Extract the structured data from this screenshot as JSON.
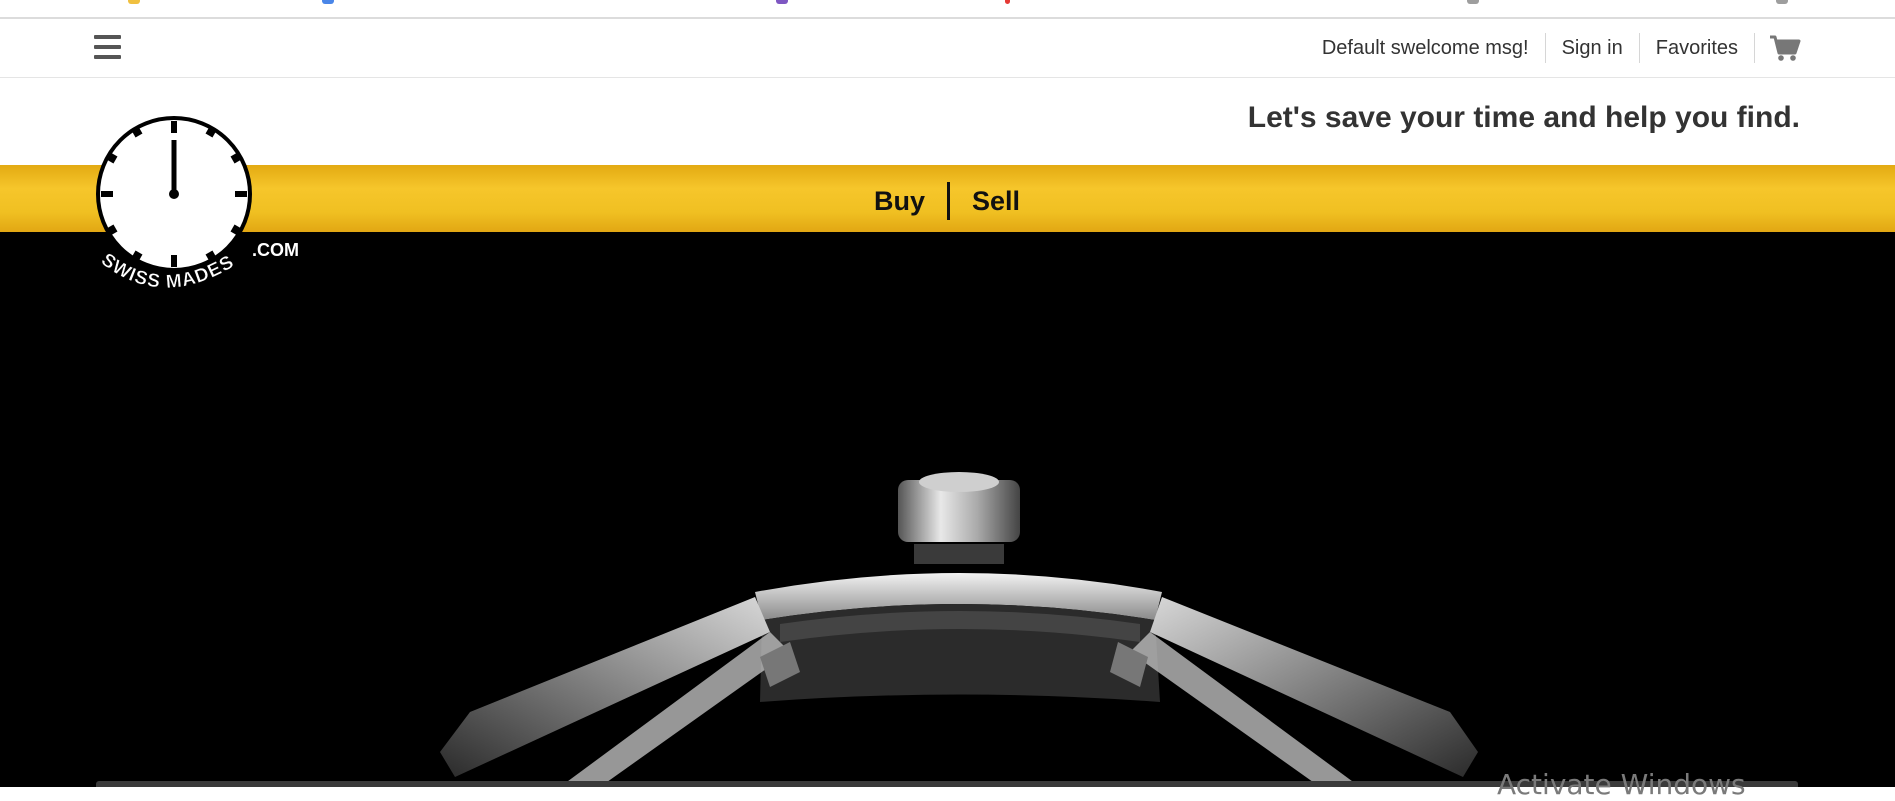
{
  "header": {
    "welcome": "Default swelcome msg!",
    "sign_in": "Sign in",
    "favorites": "Favorites",
    "tagline": "Let's save your time and help you find."
  },
  "logo": {
    "brand": "SWISS MADES",
    "suffix": ".COM"
  },
  "nav": {
    "buy": "Buy",
    "sell": "Sell"
  },
  "os_overlay": {
    "watermark": "Activate Windows"
  },
  "colors": {
    "nav_gold": "#f2c124",
    "hero_bg": "#000000",
    "text_dark": "#333333"
  },
  "icons": {
    "menu": "hamburger-menu-icon",
    "cart": "shopping-cart-icon"
  }
}
